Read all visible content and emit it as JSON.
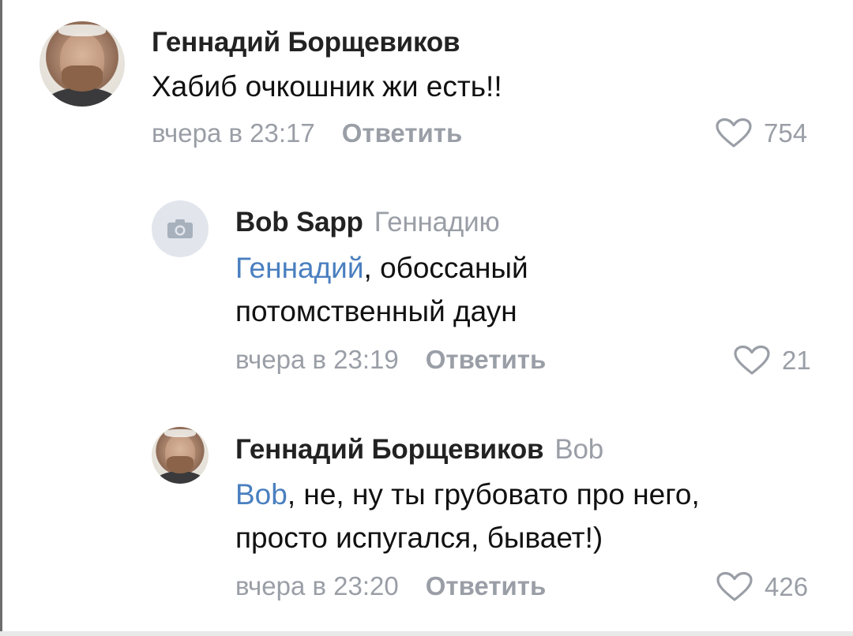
{
  "comments": [
    {
      "author": "Геннадий Борщевиков",
      "reply_to": "",
      "mention": "",
      "lines": [
        "Хабиб очкошник жи есть!!"
      ],
      "time": "вчера в 23:17",
      "reply_label": "Ответить",
      "likes": "754",
      "avatar": "user-photo"
    },
    {
      "author": "Bob Sapp",
      "reply_to": "Геннадию",
      "mention": "Геннадий",
      "lines": [
        ", обоссаный",
        "потомственный даун"
      ],
      "time": "вчера в 23:19",
      "reply_label": "Ответить",
      "likes": "21",
      "avatar": "camera-icon"
    },
    {
      "author": "Геннадий Борщевиков",
      "reply_to": "Bob",
      "mention": "Bob",
      "lines": [
        ", не, ну ты грубовато про него,",
        "просто испугался, бывает!)"
      ],
      "time": "вчера в 23:20",
      "reply_label": "Ответить",
      "likes": "426",
      "avatar": "user-photo"
    }
  ],
  "colors": {
    "name": "#222222",
    "meta": "#9a9ea6",
    "mention": "#4a7fbf",
    "camera_bg": "#e2e6ec",
    "camera_fg": "#a7b0bd"
  }
}
